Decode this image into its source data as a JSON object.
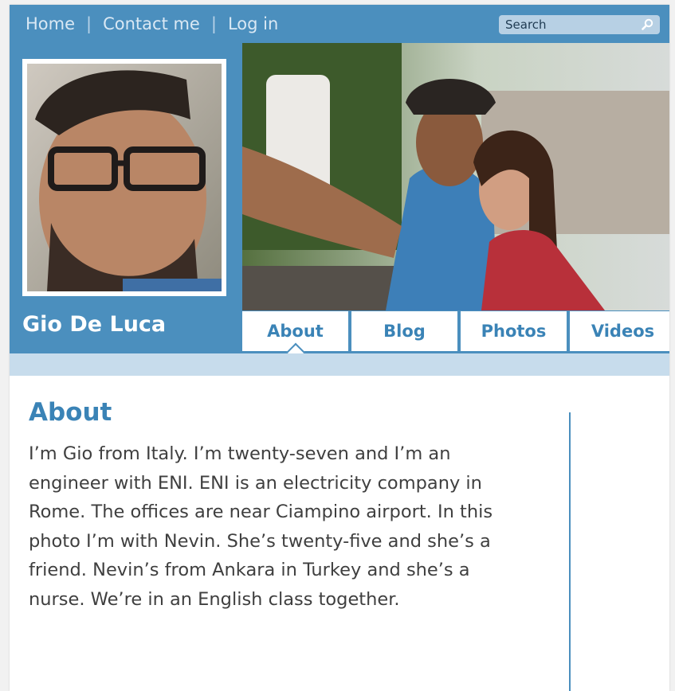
{
  "topnav": {
    "items": [
      "Home",
      "Contact me",
      "Log in"
    ]
  },
  "search": {
    "placeholder": "Search",
    "icon": "search-icon"
  },
  "profile": {
    "name": "Gio De Luca"
  },
  "tabs": [
    {
      "label": "About",
      "active": true
    },
    {
      "label": "Blog",
      "active": false
    },
    {
      "label": "Photos",
      "active": false
    },
    {
      "label": "Videos",
      "active": false
    }
  ],
  "about": {
    "title": "About",
    "body": "I’m Gio from Italy. I’m twenty-seven and I’m an engineer with ENI. ENI is an electricity company in Rome. The offices are near Ciampino airport. In this photo I’m with Nevin. She’s twenty-five and she’s a friend. Nevin’s from Ankara in Turkey and she’s a nurse. We’re in an English class together."
  },
  "colors": {
    "header_blue": "#4b8fbe",
    "accent_blue": "#3a83b6",
    "strip_light_blue": "#c7dcec",
    "search_field": "#b7d0e4"
  }
}
